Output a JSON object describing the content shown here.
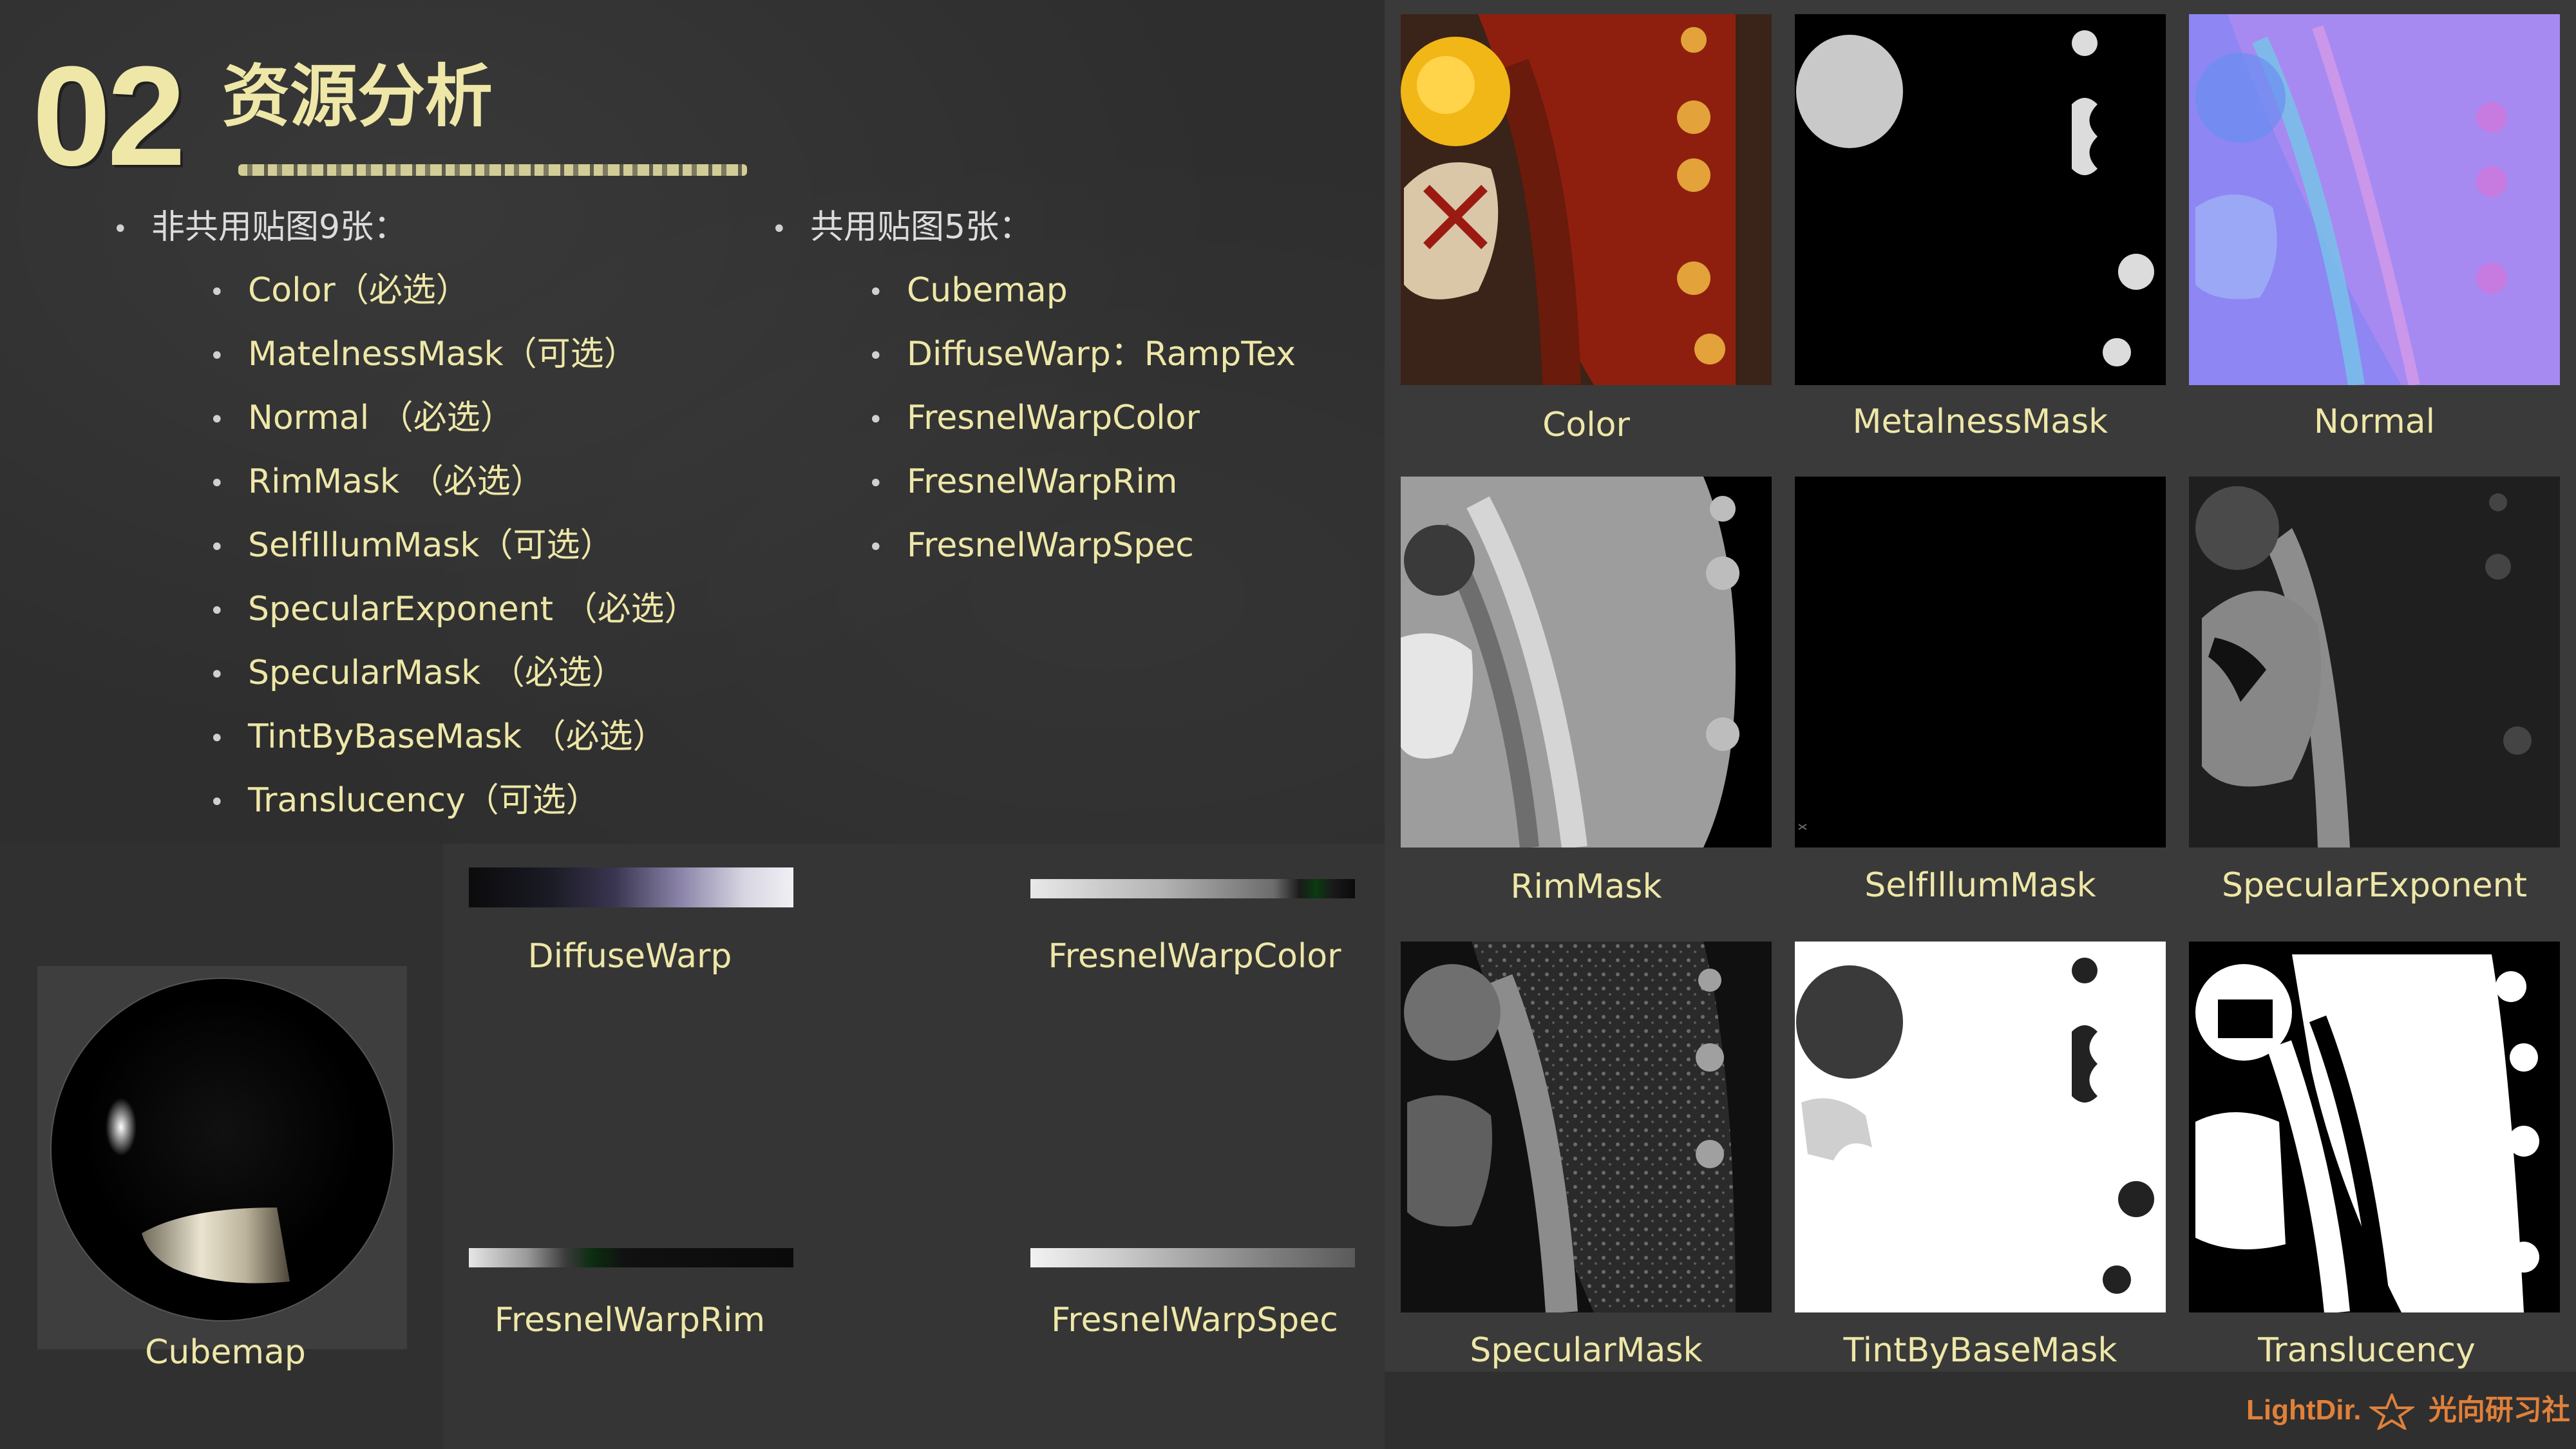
{
  "header": {
    "number": "02",
    "title": "资源分析"
  },
  "left_list": {
    "heading": "非共用贴图9张：",
    "items": [
      "Color（必选）",
      "MatelnessMask（可选）",
      "Normal （必选）",
      "RimMask （必选）",
      "SelfIllumMask（可选）",
      "SpecularExponent （必选）",
      "SpecularMask （必选）",
      "TintByBaseMask （必选）",
      "Translucency（可选）"
    ]
  },
  "right_list": {
    "heading": "共用贴图5张：",
    "items": [
      "Cubemap",
      "DiffuseWarp：RampTex",
      "FresnelWarpColor",
      "FresnelWarpRim",
      "FresnelWarpSpec"
    ]
  },
  "thumbnails": [
    {
      "caption": "Color"
    },
    {
      "caption": "MetalnessMask"
    },
    {
      "caption": "Normal"
    },
    {
      "caption": "RimMask"
    },
    {
      "caption": "SelfIllumMask"
    },
    {
      "caption": "SpecularExponent"
    },
    {
      "caption": "SpecularMask"
    },
    {
      "caption": "TintByBaseMask"
    },
    {
      "caption": "Translucency"
    }
  ],
  "ramps": [
    {
      "caption": "DiffuseWarp"
    },
    {
      "caption": "FresnelWarpColor"
    },
    {
      "caption": "FresnelWarpRim"
    },
    {
      "caption": "FresnelWarpSpec"
    }
  ],
  "cubemap": {
    "caption": "Cubemap"
  },
  "logo": {
    "brand": "LightDir.",
    "name": "光向研习社"
  },
  "colors": {
    "accent_text": "#eee7a8",
    "logo": "#e0803a"
  }
}
